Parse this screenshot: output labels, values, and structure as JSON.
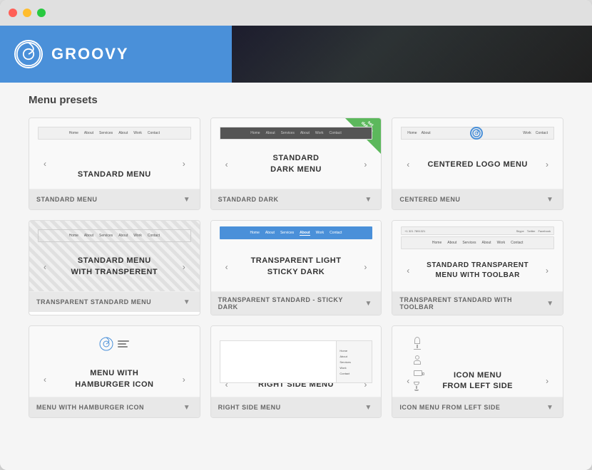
{
  "window": {
    "dots": [
      "red",
      "yellow",
      "green"
    ]
  },
  "hero": {
    "brand_name": "GROOVY",
    "brand_icon": "dj"
  },
  "presets": {
    "title": "Menu presets",
    "cards": [
      {
        "id": "standard-menu",
        "preview_label": "STANDARD MENU",
        "footer_label": "STANDARD MENU",
        "nav_items": [
          "Home",
          "About",
          "Services",
          "About",
          "Work",
          "Contact"
        ],
        "variant": "standard",
        "is_default": false
      },
      {
        "id": "standard-dark",
        "preview_label": "STANDARD\nDARK MENU",
        "footer_label": "STANDARD DARK",
        "nav_items": [
          "Home",
          "About",
          "Services",
          "About",
          "Work",
          "Contact"
        ],
        "variant": "dark",
        "is_default": true
      },
      {
        "id": "centered-menu",
        "preview_label": "CENTERED LOGO MENU",
        "footer_label": "CENTERED MENU",
        "nav_items": [
          "Home",
          "About",
          "Work",
          "Contact"
        ],
        "variant": "centered",
        "is_default": false
      },
      {
        "id": "transparent-standard",
        "preview_label": "STANDARD MENU\nWITH TRANSPERENT",
        "footer_label": "TRANSPARENT STANDARD MENU",
        "nav_items": [
          "Home",
          "About",
          "Services",
          "About",
          "Work",
          "Contact"
        ],
        "variant": "transparent",
        "is_default": false
      },
      {
        "id": "transparent-sticky-dark",
        "preview_label": "TRANSPARENT LIGHT\nSTICKY DARK",
        "footer_label": "TRANSPARENT STANDARD - STICKY DARK",
        "nav_items": [
          "Home",
          "About",
          "Services",
          "About",
          "Work",
          "Contact"
        ],
        "variant": "transparent-dark",
        "is_default": false
      },
      {
        "id": "transparent-toolbar",
        "preview_label": "STANDARD TRANSPARENT\nMENU WITH TOOLBAR",
        "footer_label": "TRANSPARENT STANDARD WITH TOOLBAR",
        "nav_items": [
          "Home",
          "About",
          "Services",
          "About",
          "Work",
          "Contact"
        ],
        "toolbar_items": [
          "Skype",
          "Twitter",
          "Facebook"
        ],
        "toolbar_left": "+1 321 7891321",
        "variant": "toolbar",
        "is_default": false
      },
      {
        "id": "hamburger-menu",
        "preview_label": "MENU WITH\nHAMBURGER ICON",
        "footer_label": "MENU WITH HAMBURGER ICON",
        "variant": "hamburger",
        "is_default": false
      },
      {
        "id": "right-side-menu",
        "preview_label": "RIGHT SIDE MENU",
        "footer_label": "RIGHT SIDE MENU",
        "right_menu_items": [
          "Home",
          "About",
          "Services",
          "Work",
          "Contact"
        ],
        "variant": "right-side",
        "is_default": false
      },
      {
        "id": "icon-menu-left",
        "preview_label": "ICON MENU\nFROM LEFT SIDE",
        "footer_label": "ICON MENU FROM LEFT SIDE",
        "variant": "icon-left",
        "is_default": false
      }
    ]
  },
  "labels": {
    "default_badge_line1": "set",
    "default_badge_line2": "default"
  }
}
